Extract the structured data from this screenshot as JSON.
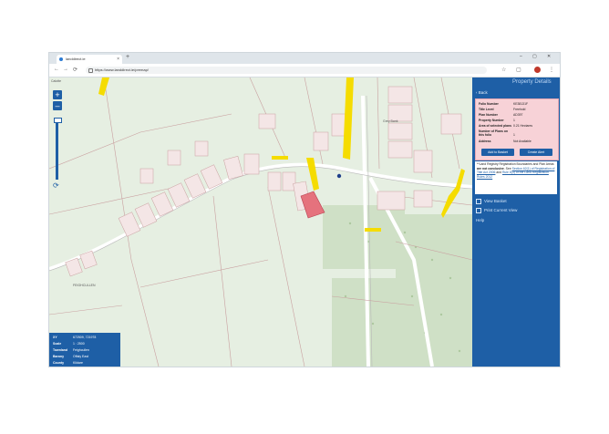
{
  "browser": {
    "tab_title": "landdirect.ie",
    "tab_close": "×",
    "new_tab": "+",
    "url": "https://www.landdirect.ie/premap/",
    "window_controls": [
      "–",
      "▢",
      "✕"
    ]
  },
  "map": {
    "top_left_label": "Calotte",
    "townland_label": "FEIGHCULLEN",
    "place_label": "Grey Bank",
    "zoom_in": "+",
    "zoom_out": "–",
    "refresh": "⟳",
    "colors": {
      "background": "#e6efe2",
      "plot": "#e5727d",
      "yellow": "#f5dc00"
    }
  },
  "infobox": {
    "rows": [
      {
        "key": "XY",
        "value": "672509, 721978"
      },
      {
        "key": "Scale",
        "value": "1 : 2500"
      },
      {
        "key": "Townland",
        "value": "Feighcullen"
      },
      {
        "key": "Barony",
        "value": "Offaly East"
      },
      {
        "key": "County",
        "value": "Kildare"
      }
    ]
  },
  "panel": {
    "title": "Property Details",
    "back": "Back",
    "details": [
      {
        "key": "Folio Number",
        "value": "KE38131F"
      },
      {
        "key": "Title Level",
        "value": "Freehold"
      },
      {
        "key": "Plan Number",
        "value": "AD397"
      },
      {
        "key": "Property Number",
        "value": "1"
      },
      {
        "key": "Area of selected plans",
        "value": "0.21 Hectares"
      },
      {
        "key": "Number of Plans on this folio",
        "value": "1"
      },
      {
        "key": "Address",
        "value": "Not Available"
      }
    ],
    "add_to_basket": "Add to Basket",
    "create_alert": "Create Alert",
    "note_prefix": "**Land Registry Registration Boundaries and Plan Areas ",
    "note_bold": "are not conclusive",
    "note_mid": ". See ",
    "note_link1": "Section 62(1) of Registration of Title Act 2006",
    "note_and": " and ",
    "note_link2": "Rule 8(3) of the Land Registration Rules 2012",
    "view_basket": "View Basket",
    "print_view": "Print Current View",
    "help": "Help"
  }
}
